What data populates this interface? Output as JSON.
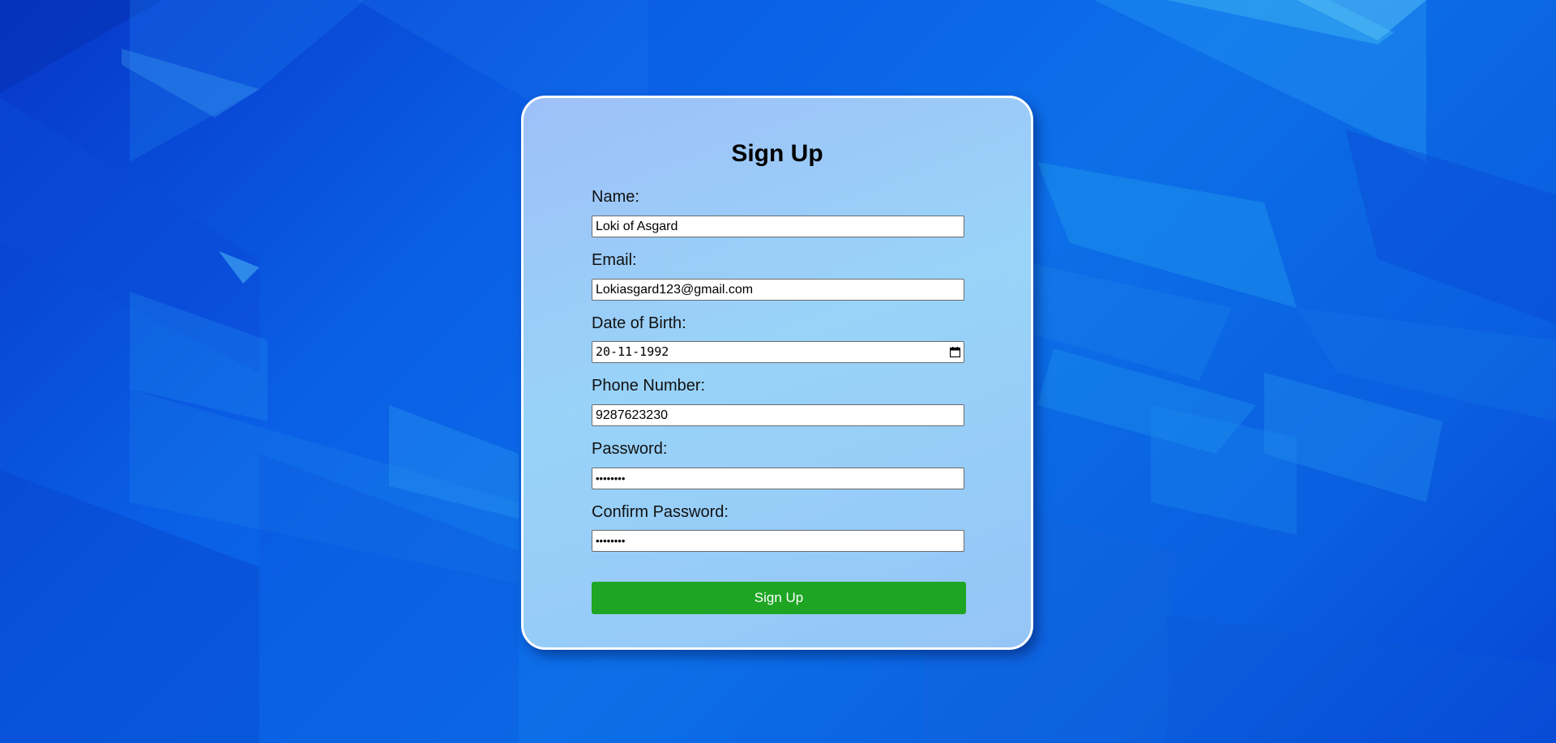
{
  "form": {
    "title": "Sign Up",
    "fields": {
      "name": {
        "label": "Name:",
        "value": "Loki of Asgard"
      },
      "email": {
        "label": "Email:",
        "value": "Lokiasgard123@gmail.com"
      },
      "dob": {
        "label": "Date of Birth:",
        "value": "20-11-1992",
        "icon": "calendar-icon"
      },
      "phone": {
        "label": "Phone Number:",
        "value": "9287623230"
      },
      "password": {
        "label": "Password:",
        "value": "••••••••"
      },
      "confirm_password": {
        "label": "Confirm Password:",
        "value": "••••••••"
      }
    },
    "submit_label": "Sign Up"
  },
  "colors": {
    "background": "#0a5fe6",
    "card": "#a5d2f8",
    "button": "#1ea523",
    "button_text": "#ffffff",
    "card_border": "#ffffff"
  }
}
